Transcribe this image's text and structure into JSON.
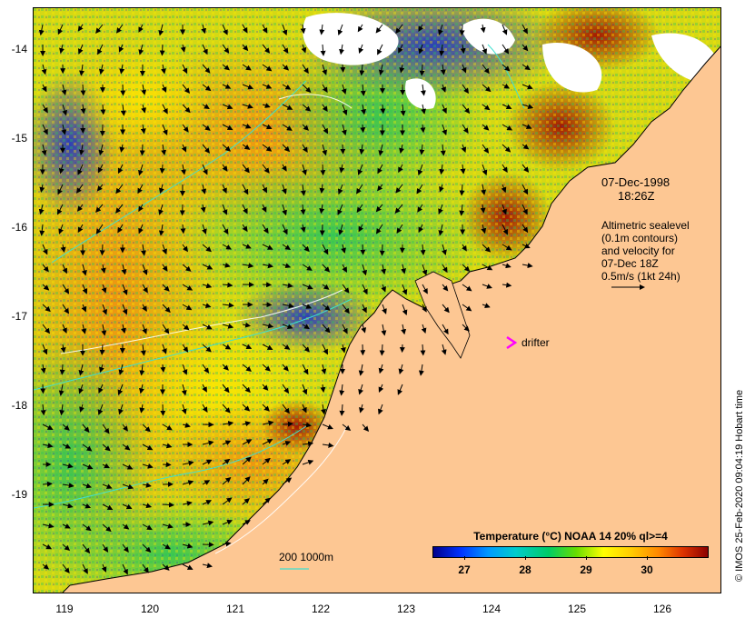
{
  "map": {
    "date": "07-Dec-1998",
    "time": "18:26Z",
    "altimetric_info": [
      "Altimetric sealevel",
      "(0.1m contours)",
      "and velocity for",
      "07-Dec 18Z",
      "0.5m/s (1kt 24h)"
    ],
    "drifter_label": "drifter",
    "depth_legend": "200  1000m",
    "credit": "© IMOS 25-Feb-2020 09:04:19 Hobart time",
    "colors": {
      "land": "#fdc793",
      "cloud": "#ffffff",
      "drifter": "#ff00ff",
      "contour": "#40e0d0",
      "depth": "#40e0d0"
    }
  },
  "axes": {
    "x_ticks": [
      "119",
      "120",
      "121",
      "122",
      "123",
      "124",
      "125",
      "126"
    ],
    "y_ticks": [
      "-14",
      "-15",
      "-16",
      "-17",
      "-18",
      "-19"
    ]
  },
  "colorbar": {
    "title": "Temperature (°C) NOAA 14 20% ql>=4",
    "labels": [
      "27",
      "28",
      "29",
      "30"
    ]
  }
}
